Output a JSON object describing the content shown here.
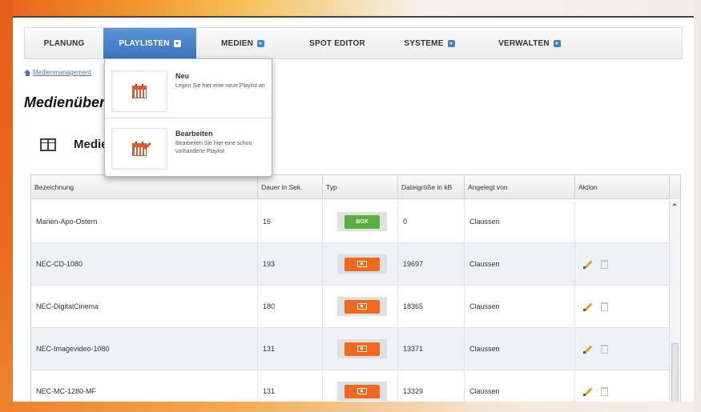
{
  "nav": {
    "items": [
      {
        "label": "PLANUNG",
        "has_caret": false,
        "active": false
      },
      {
        "label": "PLAYLISTEN",
        "has_caret": true,
        "active": true
      },
      {
        "label": "MEDIEN",
        "has_caret": true,
        "active": false
      },
      {
        "label": "SPOT EDITOR",
        "has_caret": false,
        "active": false
      },
      {
        "label": "SYSTEME",
        "has_caret": true,
        "active": false
      },
      {
        "label": "VERWALTEN",
        "has_caret": true,
        "active": false
      }
    ]
  },
  "breadcrumb": {
    "label": "Medienmanagement"
  },
  "page": {
    "title": "Medienübersicht",
    "section_title": "Medien"
  },
  "dropdown": {
    "items": [
      {
        "title": "Neu",
        "description": "Legen Sie hier eine neue Playlist an"
      },
      {
        "title": "Bearbeiten",
        "description": "Bearbeiten Sie hier eine schon vorhandene Playlist"
      }
    ]
  },
  "table": {
    "headers": [
      "Bezeichnung",
      "Dauer in Sek.",
      "Typ",
      "Dateigröße in kB",
      "Angelegt von",
      "Aktion"
    ],
    "rows": [
      {
        "name": "Marien-Apo-Ostern",
        "duration": "16",
        "type": "box",
        "type_label": "BOX",
        "size": "0",
        "author": "Claussen",
        "has_actions": false
      },
      {
        "name": "NEC-CD-1080",
        "duration": "193",
        "type": "video",
        "type_label": "",
        "size": "19697",
        "author": "Claussen",
        "has_actions": true
      },
      {
        "name": "NEC-DigitalCinema",
        "duration": "180",
        "type": "video",
        "type_label": "",
        "size": "18365",
        "author": "Claussen",
        "has_actions": true
      },
      {
        "name": "NEC-Imagevideo-1080",
        "duration": "131",
        "type": "video",
        "type_label": "",
        "size": "13371",
        "author": "Claussen",
        "has_actions": true
      },
      {
        "name": "NEC-MC-1280-MF",
        "duration": "131",
        "type": "video",
        "type_label": "",
        "size": "13329",
        "author": "Claussen",
        "has_actions": true
      }
    ]
  },
  "colors": {
    "accent_orange": "#e8631c",
    "nav_active_blue": "#3a74be",
    "box_green": "#57b13e",
    "video_orange": "#ef6a1f",
    "edit_yellow": "#e7a01f"
  }
}
